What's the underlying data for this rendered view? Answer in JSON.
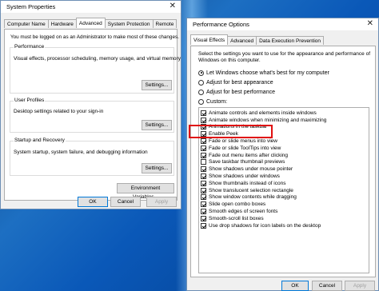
{
  "system_properties": {
    "title": "System Properties",
    "tabs": [
      "Computer Name",
      "Hardware",
      "Advanced",
      "System Protection",
      "Remote"
    ],
    "active_tab": "Advanced",
    "admin_note": "You must be logged on as an Administrator to make most of these changes.",
    "performance": {
      "title": "Performance",
      "desc": "Visual effects, processor scheduling, memory usage, and virtual memory",
      "button": "Settings..."
    },
    "user_profiles": {
      "title": "User Profiles",
      "desc": "Desktop settings related to your sign-in",
      "button": "Settings..."
    },
    "startup_recovery": {
      "title": "Startup and Recovery",
      "desc": "System startup, system failure, and debugging information",
      "button": "Settings..."
    },
    "env_button": "Environment Variables...",
    "ok": "OK",
    "cancel": "Cancel",
    "apply": "Apply"
  },
  "performance_options": {
    "title": "Performance Options",
    "tabs": [
      "Visual Effects",
      "Advanced",
      "Data Execution Prevention"
    ],
    "active_tab": "Visual Effects",
    "intro": "Select the settings you want to use for the appearance and performance of Windows on this computer.",
    "radios": [
      {
        "label": "Let Windows choose what's best for my computer",
        "selected": true
      },
      {
        "label": "Adjust for best appearance",
        "selected": false
      },
      {
        "label": "Adjust for best performance",
        "selected": false
      },
      {
        "label": "Custom:",
        "selected": false
      }
    ],
    "effects": [
      {
        "label": "Animate controls and elements inside windows",
        "checked": true
      },
      {
        "label": "Animate windows when minimizing and maximizing",
        "checked": true
      },
      {
        "label": "Animations in the taskbar",
        "checked": true
      },
      {
        "label": "Enable Peek",
        "checked": true
      },
      {
        "label": "Fade or slide menus into view",
        "checked": true
      },
      {
        "label": "Fade or slide ToolTips into view",
        "checked": true
      },
      {
        "label": "Fade out menu items after clicking",
        "checked": true
      },
      {
        "label": "Save taskbar thumbnail previews",
        "checked": false
      },
      {
        "label": "Show shadows under mouse pointer",
        "checked": true
      },
      {
        "label": "Show shadows under windows",
        "checked": true
      },
      {
        "label": "Show thumbnails instead of icons",
        "checked": true
      },
      {
        "label": "Show translucent selection rectangle",
        "checked": true
      },
      {
        "label": "Show window contents while dragging",
        "checked": true
      },
      {
        "label": "Slide open combo boxes",
        "checked": true
      },
      {
        "label": "Smooth edges of screen fonts",
        "checked": true
      },
      {
        "label": "Smooth-scroll list boxes",
        "checked": true
      },
      {
        "label": "Use drop shadows for icon labels on the desktop",
        "checked": true
      }
    ],
    "ok": "OK",
    "cancel": "Cancel",
    "apply": "Apply",
    "highlight_color": "#e01010"
  }
}
